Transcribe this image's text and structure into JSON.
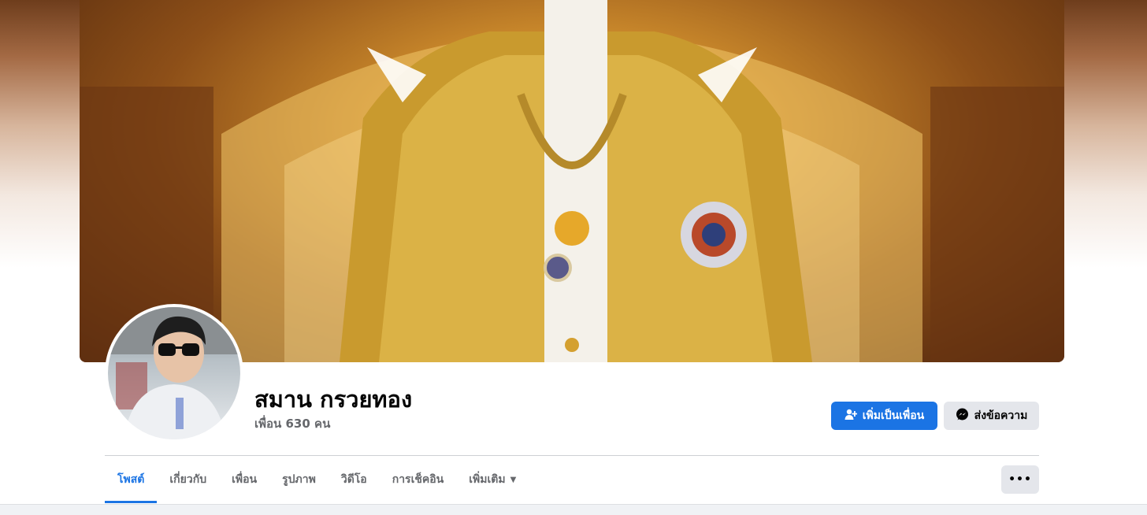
{
  "profile": {
    "name": "สมาน กรวยทอง",
    "friends_text": "เพื่อน 630 คน"
  },
  "actions": {
    "add_friend_label": "เพิ่มเป็นเพื่อน",
    "message_label": "ส่งข้อความ",
    "more_label": "•••"
  },
  "tabs": [
    {
      "label": "โพสต์",
      "active": true
    },
    {
      "label": "เกี่ยวกับ",
      "active": false
    },
    {
      "label": "เพื่อน",
      "active": false
    },
    {
      "label": "รูปภาพ",
      "active": false
    },
    {
      "label": "วิดีโอ",
      "active": false
    },
    {
      "label": "การเช็คอิน",
      "active": false
    },
    {
      "label": "เพิ่มเติม",
      "active": false
    }
  ],
  "colors": {
    "accent": "#1b74e4",
    "secondary_button": "#e4e6eb",
    "muted_text": "#65676b"
  },
  "icons": {
    "add_friend": "person-plus-icon",
    "message": "messenger-icon",
    "dropdown": "caret-down-icon",
    "more": "ellipsis-icon"
  }
}
